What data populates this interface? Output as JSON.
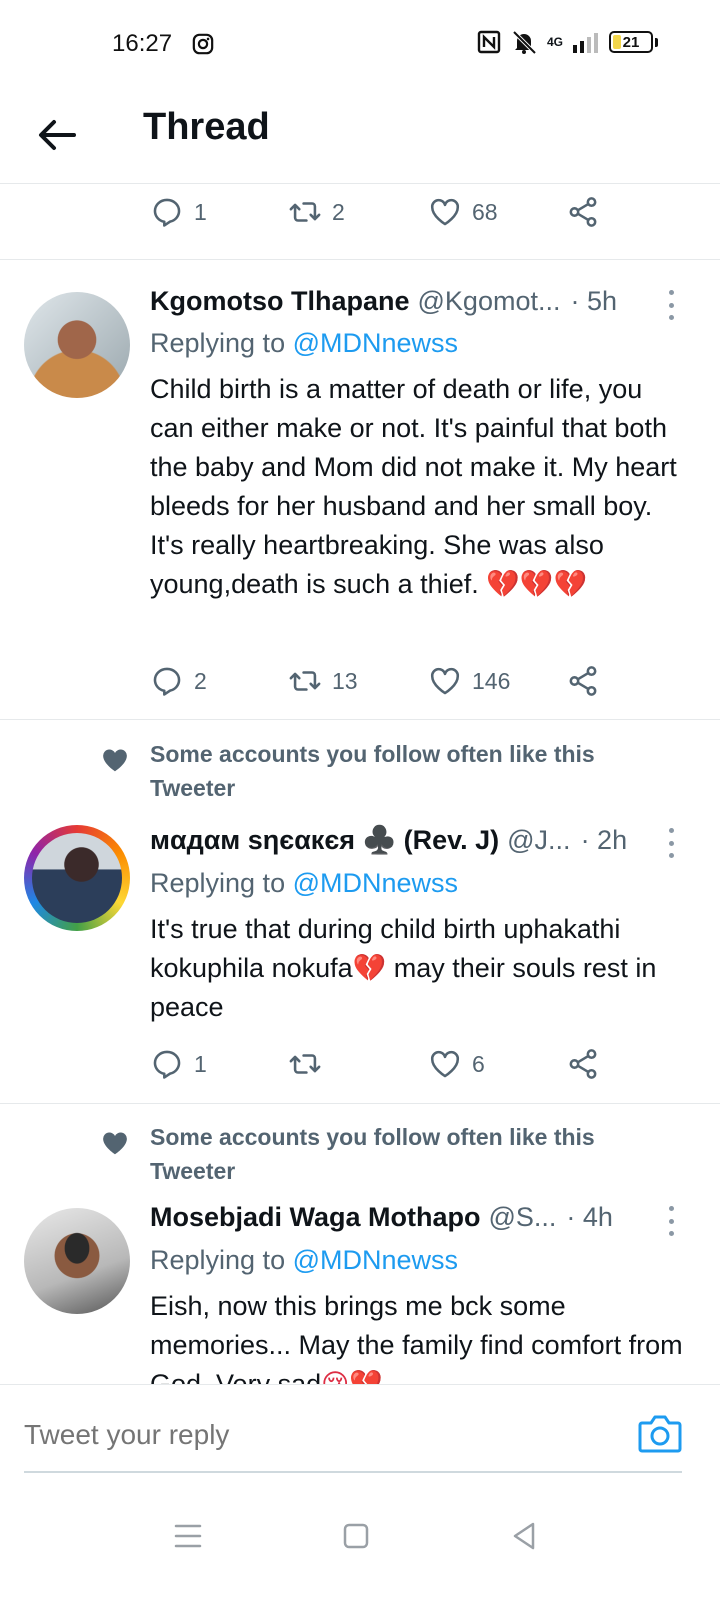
{
  "status_bar": {
    "time": "16:27",
    "network": "4G",
    "battery": "21",
    "battery_level": 0.21
  },
  "header": {
    "title": "Thread"
  },
  "top_actions": {
    "replies": "1",
    "retweets": "2",
    "likes": "68"
  },
  "tweets": [
    {
      "name": "Kgomotso Tlhapane",
      "handle": "@Kgomot...",
      "time": "· 5h",
      "replying_label": "Replying to",
      "replying_to": "@MDNnewss",
      "text": "Child birth is a matter of death or life, you can either make or not. It's painful that both the baby and Mom did not make it. My heart bleeds for her husband and her small boy. It's really heartbreaking. She was also young,death is such a thief.",
      "emoji": "💔💔💔",
      "replies": "2",
      "retweets": "13",
      "likes": "146"
    },
    {
      "social_context": "Some accounts you follow often like this Tweeter",
      "name": "мαдαм ѕηєαкєя ♣️ (Rev. J)",
      "handle": "@J...",
      "time": "· 2h",
      "replying_label": "Replying to",
      "replying_to": "@MDNnewss",
      "text_before": "It's true that during child birth uphakathi kokuphila nokufa",
      "emoji": "💔",
      "text_after": " may their souls rest in peace",
      "replies": "1",
      "retweets": "",
      "likes": "6"
    },
    {
      "social_context": "Some accounts you follow often like this Tweeter",
      "name": "Mosebjadi Waga Mothapo",
      "handle": "@S...",
      "time": "· 4h",
      "replying_label": "Replying to",
      "replying_to": "@MDNnewss",
      "text": "Eish, now this brings me bck some memories... May the family find comfort from God. Very sad",
      "emoji": "😢💔"
    }
  ],
  "composer": {
    "placeholder": "Tweet your reply"
  },
  "colors": {
    "accent": "#1d9bf0",
    "muted": "#536471",
    "divider": "#e6e9eb",
    "heart_broken": "#dd2e44"
  },
  "icons": [
    "back-arrow-icon",
    "reply-icon",
    "retweet-icon",
    "like-icon",
    "share-icon",
    "more-icon",
    "heart-icon",
    "camera-icon",
    "menu-icon",
    "home-square-icon",
    "back-triangle-icon",
    "instagram-icon",
    "nfc-icon",
    "mute-icon",
    "signal-icon",
    "battery-icon"
  ]
}
